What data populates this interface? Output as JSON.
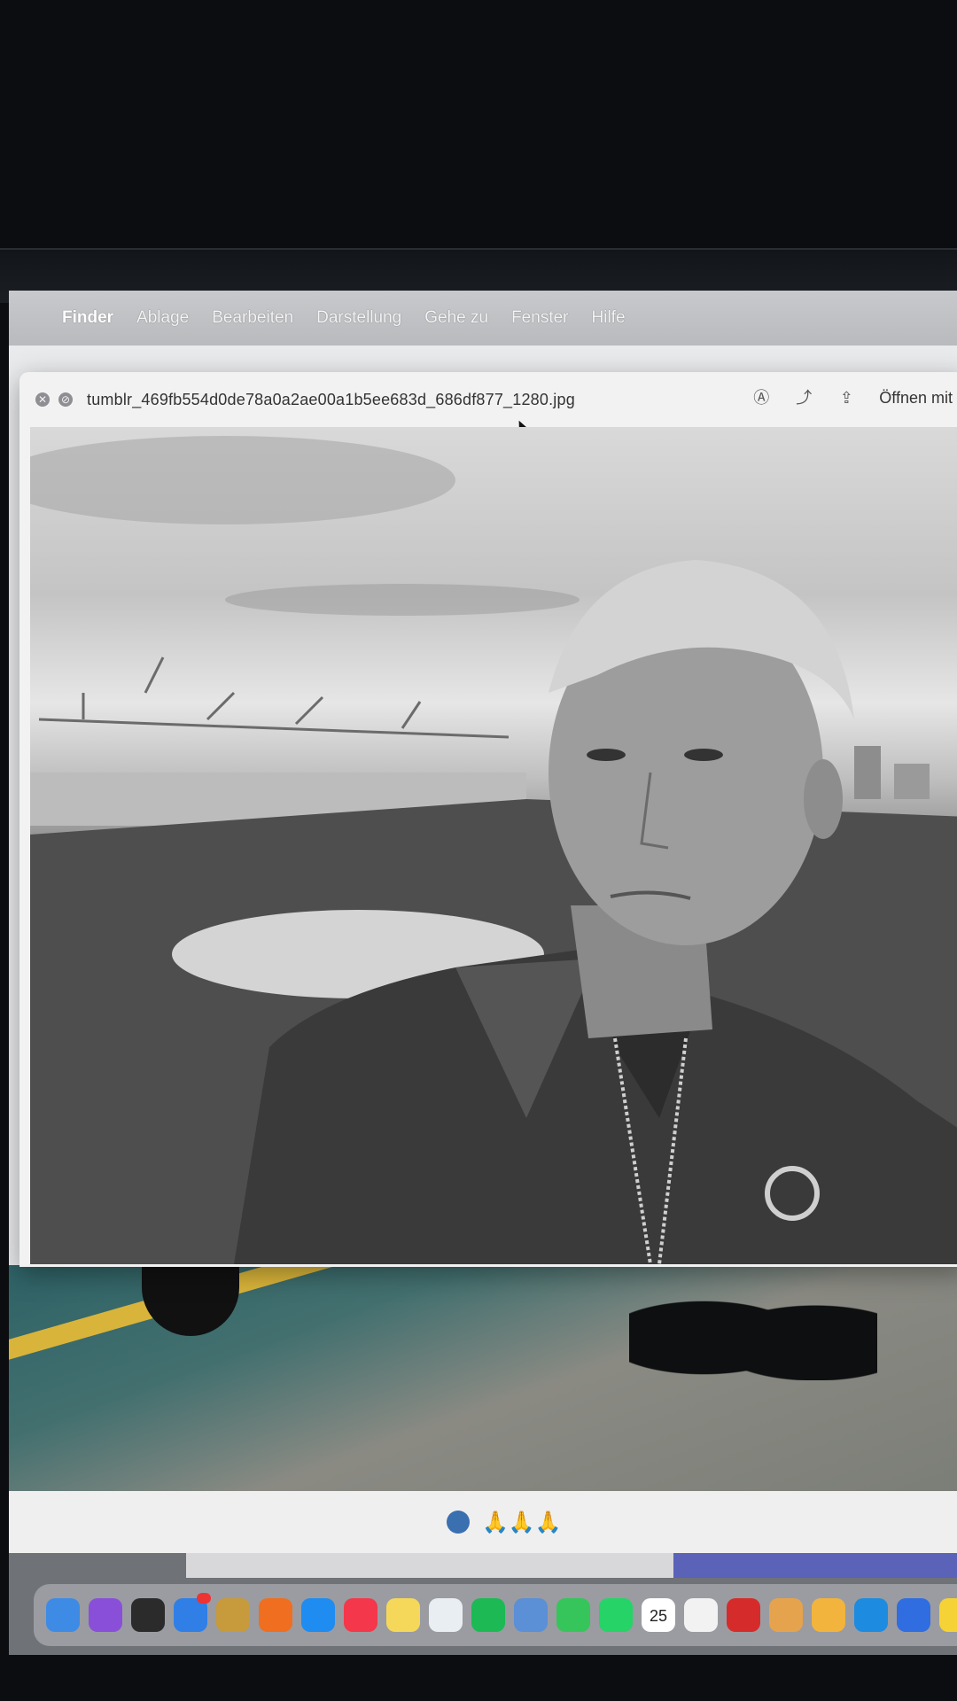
{
  "menubar": {
    "items": [
      "Finder",
      "Ablage",
      "Bearbeiten",
      "Darstellung",
      "Gehe zu",
      "Fenster",
      "Hilfe"
    ]
  },
  "preview": {
    "filename": "tumblr_469fb554d0de78a0a2ae00a1b5ee683d_686df877_1280.jpg",
    "open_with": "Öffnen mit V"
  },
  "message_bar": {
    "emoji": "🙏🙏🙏"
  },
  "dock": {
    "calendar_day": "25",
    "icons": [
      "finder-icon",
      "siri-icon",
      "mission-control-icon",
      "mail-icon",
      "notes-app-icon",
      "firefox-icon",
      "safari-icon",
      "music-icon",
      "notes-icon",
      "freeform-icon",
      "spotify-icon",
      "preview-icon",
      "messages-icon",
      "whatsapp-icon",
      "calendar-icon",
      "reminders-icon",
      "acrobat-icon",
      "launchpad-icon",
      "photos-icon",
      "skype-icon",
      "xcode-tools-icon",
      "stickies-icon"
    ],
    "colors": [
      "#3d8be5",
      "#8a4fd8",
      "#2b2b2b",
      "#2f7fe6",
      "#c79a3b",
      "#f06e1f",
      "#1e8cf0",
      "#f4374a",
      "#f5d85a",
      "#e9eef3",
      "#1db954",
      "#5b8fd6",
      "#36c55a",
      "#25d366",
      "#ffffff",
      "#f2f2f2",
      "#d62b2b",
      "#e6a34d",
      "#f2b43c",
      "#1d8be0",
      "#2f6de0",
      "#f5d236"
    ]
  }
}
